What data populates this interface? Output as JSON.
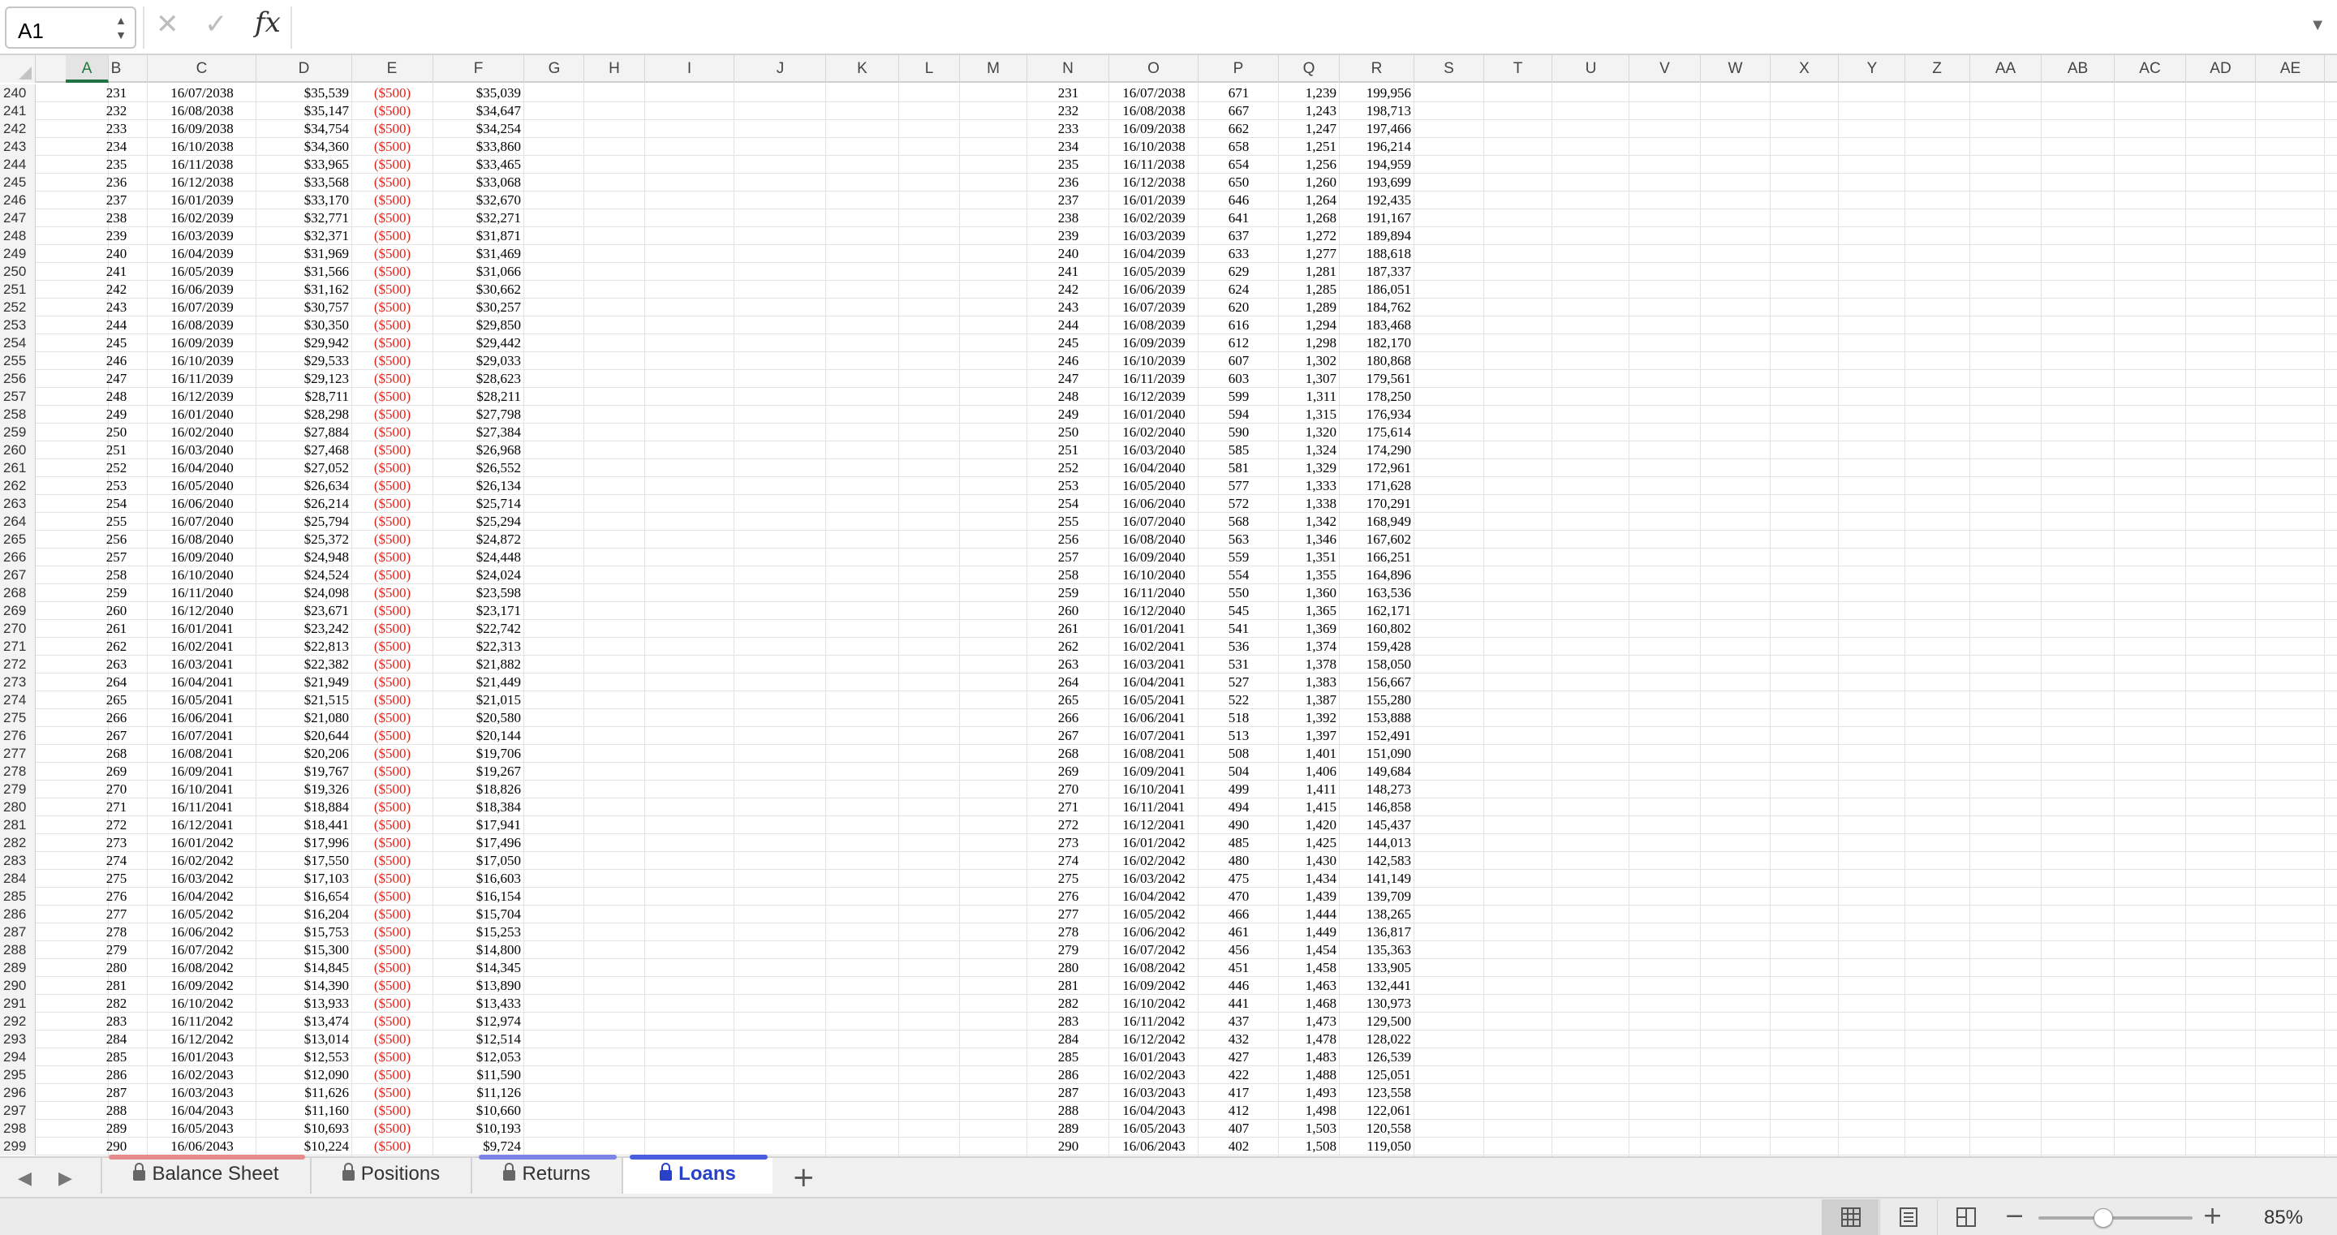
{
  "formula_bar": {
    "name_box": "A1",
    "formula": "",
    "cancel_glyph": "✕",
    "enter_glyph": "✓",
    "fx_label": "fx"
  },
  "columns": [
    "A",
    "B",
    "C",
    "D",
    "E",
    "F",
    "G",
    "H",
    "I",
    "J",
    "K",
    "L",
    "M",
    "N",
    "O",
    "P",
    "Q",
    "R",
    "S",
    "T",
    "U",
    "V",
    "W",
    "X",
    "Y",
    "Z",
    "AA",
    "AB",
    "AC",
    "AD",
    "AE"
  ],
  "active_column": "A",
  "rows": [
    {
      "r": "240",
      "b": "231",
      "c": "16/07/2038",
      "d": "$35,539",
      "e": "($500)",
      "f": "$35,039",
      "n": "231",
      "o": "16/07/2038",
      "p": "671",
      "q": "1,239",
      "rr": "199,956"
    },
    {
      "r": "241",
      "b": "232",
      "c": "16/08/2038",
      "d": "$35,147",
      "e": "($500)",
      "f": "$34,647",
      "n": "232",
      "o": "16/08/2038",
      "p": "667",
      "q": "1,243",
      "rr": "198,713"
    },
    {
      "r": "242",
      "b": "233",
      "c": "16/09/2038",
      "d": "$34,754",
      "e": "($500)",
      "f": "$34,254",
      "n": "233",
      "o": "16/09/2038",
      "p": "662",
      "q": "1,247",
      "rr": "197,466"
    },
    {
      "r": "243",
      "b": "234",
      "c": "16/10/2038",
      "d": "$34,360",
      "e": "($500)",
      "f": "$33,860",
      "n": "234",
      "o": "16/10/2038",
      "p": "658",
      "q": "1,251",
      "rr": "196,214"
    },
    {
      "r": "244",
      "b": "235",
      "c": "16/11/2038",
      "d": "$33,965",
      "e": "($500)",
      "f": "$33,465",
      "n": "235",
      "o": "16/11/2038",
      "p": "654",
      "q": "1,256",
      "rr": "194,959"
    },
    {
      "r": "245",
      "b": "236",
      "c": "16/12/2038",
      "d": "$33,568",
      "e": "($500)",
      "f": "$33,068",
      "n": "236",
      "o": "16/12/2038",
      "p": "650",
      "q": "1,260",
      "rr": "193,699"
    },
    {
      "r": "246",
      "b": "237",
      "c": "16/01/2039",
      "d": "$33,170",
      "e": "($500)",
      "f": "$32,670",
      "n": "237",
      "o": "16/01/2039",
      "p": "646",
      "q": "1,264",
      "rr": "192,435"
    },
    {
      "r": "247",
      "b": "238",
      "c": "16/02/2039",
      "d": "$32,771",
      "e": "($500)",
      "f": "$32,271",
      "n": "238",
      "o": "16/02/2039",
      "p": "641",
      "q": "1,268",
      "rr": "191,167"
    },
    {
      "r": "248",
      "b": "239",
      "c": "16/03/2039",
      "d": "$32,371",
      "e": "($500)",
      "f": "$31,871",
      "n": "239",
      "o": "16/03/2039",
      "p": "637",
      "q": "1,272",
      "rr": "189,894"
    },
    {
      "r": "249",
      "b": "240",
      "c": "16/04/2039",
      "d": "$31,969",
      "e": "($500)",
      "f": "$31,469",
      "n": "240",
      "o": "16/04/2039",
      "p": "633",
      "q": "1,277",
      "rr": "188,618"
    },
    {
      "r": "250",
      "b": "241",
      "c": "16/05/2039",
      "d": "$31,566",
      "e": "($500)",
      "f": "$31,066",
      "n": "241",
      "o": "16/05/2039",
      "p": "629",
      "q": "1,281",
      "rr": "187,337"
    },
    {
      "r": "251",
      "b": "242",
      "c": "16/06/2039",
      "d": "$31,162",
      "e": "($500)",
      "f": "$30,662",
      "n": "242",
      "o": "16/06/2039",
      "p": "624",
      "q": "1,285",
      "rr": "186,051"
    },
    {
      "r": "252",
      "b": "243",
      "c": "16/07/2039",
      "d": "$30,757",
      "e": "($500)",
      "f": "$30,257",
      "n": "243",
      "o": "16/07/2039",
      "p": "620",
      "q": "1,289",
      "rr": "184,762"
    },
    {
      "r": "253",
      "b": "244",
      "c": "16/08/2039",
      "d": "$30,350",
      "e": "($500)",
      "f": "$29,850",
      "n": "244",
      "o": "16/08/2039",
      "p": "616",
      "q": "1,294",
      "rr": "183,468"
    },
    {
      "r": "254",
      "b": "245",
      "c": "16/09/2039",
      "d": "$29,942",
      "e": "($500)",
      "f": "$29,442",
      "n": "245",
      "o": "16/09/2039",
      "p": "612",
      "q": "1,298",
      "rr": "182,170"
    },
    {
      "r": "255",
      "b": "246",
      "c": "16/10/2039",
      "d": "$29,533",
      "e": "($500)",
      "f": "$29,033",
      "n": "246",
      "o": "16/10/2039",
      "p": "607",
      "q": "1,302",
      "rr": "180,868"
    },
    {
      "r": "256",
      "b": "247",
      "c": "16/11/2039",
      "d": "$29,123",
      "e": "($500)",
      "f": "$28,623",
      "n": "247",
      "o": "16/11/2039",
      "p": "603",
      "q": "1,307",
      "rr": "179,561"
    },
    {
      "r": "257",
      "b": "248",
      "c": "16/12/2039",
      "d": "$28,711",
      "e": "($500)",
      "f": "$28,211",
      "n": "248",
      "o": "16/12/2039",
      "p": "599",
      "q": "1,311",
      "rr": "178,250"
    },
    {
      "r": "258",
      "b": "249",
      "c": "16/01/2040",
      "d": "$28,298",
      "e": "($500)",
      "f": "$27,798",
      "n": "249",
      "o": "16/01/2040",
      "p": "594",
      "q": "1,315",
      "rr": "176,934"
    },
    {
      "r": "259",
      "b": "250",
      "c": "16/02/2040",
      "d": "$27,884",
      "e": "($500)",
      "f": "$27,384",
      "n": "250",
      "o": "16/02/2040",
      "p": "590",
      "q": "1,320",
      "rr": "175,614"
    },
    {
      "r": "260",
      "b": "251",
      "c": "16/03/2040",
      "d": "$27,468",
      "e": "($500)",
      "f": "$26,968",
      "n": "251",
      "o": "16/03/2040",
      "p": "585",
      "q": "1,324",
      "rr": "174,290"
    },
    {
      "r": "261",
      "b": "252",
      "c": "16/04/2040",
      "d": "$27,052",
      "e": "($500)",
      "f": "$26,552",
      "n": "252",
      "o": "16/04/2040",
      "p": "581",
      "q": "1,329",
      "rr": "172,961"
    },
    {
      "r": "262",
      "b": "253",
      "c": "16/05/2040",
      "d": "$26,634",
      "e": "($500)",
      "f": "$26,134",
      "n": "253",
      "o": "16/05/2040",
      "p": "577",
      "q": "1,333",
      "rr": "171,628"
    },
    {
      "r": "263",
      "b": "254",
      "c": "16/06/2040",
      "d": "$26,214",
      "e": "($500)",
      "f": "$25,714",
      "n": "254",
      "o": "16/06/2040",
      "p": "572",
      "q": "1,338",
      "rr": "170,291"
    },
    {
      "r": "264",
      "b": "255",
      "c": "16/07/2040",
      "d": "$25,794",
      "e": "($500)",
      "f": "$25,294",
      "n": "255",
      "o": "16/07/2040",
      "p": "568",
      "q": "1,342",
      "rr": "168,949"
    },
    {
      "r": "265",
      "b": "256",
      "c": "16/08/2040",
      "d": "$25,372",
      "e": "($500)",
      "f": "$24,872",
      "n": "256",
      "o": "16/08/2040",
      "p": "563",
      "q": "1,346",
      "rr": "167,602"
    },
    {
      "r": "266",
      "b": "257",
      "c": "16/09/2040",
      "d": "$24,948",
      "e": "($500)",
      "f": "$24,448",
      "n": "257",
      "o": "16/09/2040",
      "p": "559",
      "q": "1,351",
      "rr": "166,251"
    },
    {
      "r": "267",
      "b": "258",
      "c": "16/10/2040",
      "d": "$24,524",
      "e": "($500)",
      "f": "$24,024",
      "n": "258",
      "o": "16/10/2040",
      "p": "554",
      "q": "1,355",
      "rr": "164,896"
    },
    {
      "r": "268",
      "b": "259",
      "c": "16/11/2040",
      "d": "$24,098",
      "e": "($500)",
      "f": "$23,598",
      "n": "259",
      "o": "16/11/2040",
      "p": "550",
      "q": "1,360",
      "rr": "163,536"
    },
    {
      "r": "269",
      "b": "260",
      "c": "16/12/2040",
      "d": "$23,671",
      "e": "($500)",
      "f": "$23,171",
      "n": "260",
      "o": "16/12/2040",
      "p": "545",
      "q": "1,365",
      "rr": "162,171"
    },
    {
      "r": "270",
      "b": "261",
      "c": "16/01/2041",
      "d": "$23,242",
      "e": "($500)",
      "f": "$22,742",
      "n": "261",
      "o": "16/01/2041",
      "p": "541",
      "q": "1,369",
      "rr": "160,802"
    },
    {
      "r": "271",
      "b": "262",
      "c": "16/02/2041",
      "d": "$22,813",
      "e": "($500)",
      "f": "$22,313",
      "n": "262",
      "o": "16/02/2041",
      "p": "536",
      "q": "1,374",
      "rr": "159,428"
    },
    {
      "r": "272",
      "b": "263",
      "c": "16/03/2041",
      "d": "$22,382",
      "e": "($500)",
      "f": "$21,882",
      "n": "263",
      "o": "16/03/2041",
      "p": "531",
      "q": "1,378",
      "rr": "158,050"
    },
    {
      "r": "273",
      "b": "264",
      "c": "16/04/2041",
      "d": "$21,949",
      "e": "($500)",
      "f": "$21,449",
      "n": "264",
      "o": "16/04/2041",
      "p": "527",
      "q": "1,383",
      "rr": "156,667"
    },
    {
      "r": "274",
      "b": "265",
      "c": "16/05/2041",
      "d": "$21,515",
      "e": "($500)",
      "f": "$21,015",
      "n": "265",
      "o": "16/05/2041",
      "p": "522",
      "q": "1,387",
      "rr": "155,280"
    },
    {
      "r": "275",
      "b": "266",
      "c": "16/06/2041",
      "d": "$21,080",
      "e": "($500)",
      "f": "$20,580",
      "n": "266",
      "o": "16/06/2041",
      "p": "518",
      "q": "1,392",
      "rr": "153,888"
    },
    {
      "r": "276",
      "b": "267",
      "c": "16/07/2041",
      "d": "$20,644",
      "e": "($500)",
      "f": "$20,144",
      "n": "267",
      "o": "16/07/2041",
      "p": "513",
      "q": "1,397",
      "rr": "152,491"
    },
    {
      "r": "277",
      "b": "268",
      "c": "16/08/2041",
      "d": "$20,206",
      "e": "($500)",
      "f": "$19,706",
      "n": "268",
      "o": "16/08/2041",
      "p": "508",
      "q": "1,401",
      "rr": "151,090"
    },
    {
      "r": "278",
      "b": "269",
      "c": "16/09/2041",
      "d": "$19,767",
      "e": "($500)",
      "f": "$19,267",
      "n": "269",
      "o": "16/09/2041",
      "p": "504",
      "q": "1,406",
      "rr": "149,684"
    },
    {
      "r": "279",
      "b": "270",
      "c": "16/10/2041",
      "d": "$19,326",
      "e": "($500)",
      "f": "$18,826",
      "n": "270",
      "o": "16/10/2041",
      "p": "499",
      "q": "1,411",
      "rr": "148,273"
    },
    {
      "r": "280",
      "b": "271",
      "c": "16/11/2041",
      "d": "$18,884",
      "e": "($500)",
      "f": "$18,384",
      "n": "271",
      "o": "16/11/2041",
      "p": "494",
      "q": "1,415",
      "rr": "146,858"
    },
    {
      "r": "281",
      "b": "272",
      "c": "16/12/2041",
      "d": "$18,441",
      "e": "($500)",
      "f": "$17,941",
      "n": "272",
      "o": "16/12/2041",
      "p": "490",
      "q": "1,420",
      "rr": "145,437"
    },
    {
      "r": "282",
      "b": "273",
      "c": "16/01/2042",
      "d": "$17,996",
      "e": "($500)",
      "f": "$17,496",
      "n": "273",
      "o": "16/01/2042",
      "p": "485",
      "q": "1,425",
      "rr": "144,013"
    },
    {
      "r": "283",
      "b": "274",
      "c": "16/02/2042",
      "d": "$17,550",
      "e": "($500)",
      "f": "$17,050",
      "n": "274",
      "o": "16/02/2042",
      "p": "480",
      "q": "1,430",
      "rr": "142,583"
    },
    {
      "r": "284",
      "b": "275",
      "c": "16/03/2042",
      "d": "$17,103",
      "e": "($500)",
      "f": "$16,603",
      "n": "275",
      "o": "16/03/2042",
      "p": "475",
      "q": "1,434",
      "rr": "141,149"
    },
    {
      "r": "285",
      "b": "276",
      "c": "16/04/2042",
      "d": "$16,654",
      "e": "($500)",
      "f": "$16,154",
      "n": "276",
      "o": "16/04/2042",
      "p": "470",
      "q": "1,439",
      "rr": "139,709"
    },
    {
      "r": "286",
      "b": "277",
      "c": "16/05/2042",
      "d": "$16,204",
      "e": "($500)",
      "f": "$15,704",
      "n": "277",
      "o": "16/05/2042",
      "p": "466",
      "q": "1,444",
      "rr": "138,265"
    },
    {
      "r": "287",
      "b": "278",
      "c": "16/06/2042",
      "d": "$15,753",
      "e": "($500)",
      "f": "$15,253",
      "n": "278",
      "o": "16/06/2042",
      "p": "461",
      "q": "1,449",
      "rr": "136,817"
    },
    {
      "r": "288",
      "b": "279",
      "c": "16/07/2042",
      "d": "$15,300",
      "e": "($500)",
      "f": "$14,800",
      "n": "279",
      "o": "16/07/2042",
      "p": "456",
      "q": "1,454",
      "rr": "135,363"
    },
    {
      "r": "289",
      "b": "280",
      "c": "16/08/2042",
      "d": "$14,845",
      "e": "($500)",
      "f": "$14,345",
      "n": "280",
      "o": "16/08/2042",
      "p": "451",
      "q": "1,458",
      "rr": "133,905"
    },
    {
      "r": "290",
      "b": "281",
      "c": "16/09/2042",
      "d": "$14,390",
      "e": "($500)",
      "f": "$13,890",
      "n": "281",
      "o": "16/09/2042",
      "p": "446",
      "q": "1,463",
      "rr": "132,441"
    },
    {
      "r": "291",
      "b": "282",
      "c": "16/10/2042",
      "d": "$13,933",
      "e": "($500)",
      "f": "$13,433",
      "n": "282",
      "o": "16/10/2042",
      "p": "441",
      "q": "1,468",
      "rr": "130,973"
    },
    {
      "r": "292",
      "b": "283",
      "c": "16/11/2042",
      "d": "$13,474",
      "e": "($500)",
      "f": "$12,974",
      "n": "283",
      "o": "16/11/2042",
      "p": "437",
      "q": "1,473",
      "rr": "129,500"
    },
    {
      "r": "293",
      "b": "284",
      "c": "16/12/2042",
      "d": "$13,014",
      "e": "($500)",
      "f": "$12,514",
      "n": "284",
      "o": "16/12/2042",
      "p": "432",
      "q": "1,478",
      "rr": "128,022"
    },
    {
      "r": "294",
      "b": "285",
      "c": "16/01/2043",
      "d": "$12,553",
      "e": "($500)",
      "f": "$12,053",
      "n": "285",
      "o": "16/01/2043",
      "p": "427",
      "q": "1,483",
      "rr": "126,539"
    },
    {
      "r": "295",
      "b": "286",
      "c": "16/02/2043",
      "d": "$12,090",
      "e": "($500)",
      "f": "$11,590",
      "n": "286",
      "o": "16/02/2043",
      "p": "422",
      "q": "1,488",
      "rr": "125,051"
    },
    {
      "r": "296",
      "b": "287",
      "c": "16/03/2043",
      "d": "$11,626",
      "e": "($500)",
      "f": "$11,126",
      "n": "287",
      "o": "16/03/2043",
      "p": "417",
      "q": "1,493",
      "rr": "123,558"
    },
    {
      "r": "297",
      "b": "288",
      "c": "16/04/2043",
      "d": "$11,160",
      "e": "($500)",
      "f": "$10,660",
      "n": "288",
      "o": "16/04/2043",
      "p": "412",
      "q": "1,498",
      "rr": "122,061"
    },
    {
      "r": "298",
      "b": "289",
      "c": "16/05/2043",
      "d": "$10,693",
      "e": "($500)",
      "f": "$10,193",
      "n": "289",
      "o": "16/05/2043",
      "p": "407",
      "q": "1,503",
      "rr": "120,558"
    },
    {
      "r": "299",
      "b": "290",
      "c": "16/06/2043",
      "d": "$10,224",
      "e": "($500)",
      "f": "$9,724",
      "n": "290",
      "o": "16/06/2043",
      "p": "402",
      "q": "1,508",
      "rr": "119,050"
    }
  ],
  "tabs": [
    {
      "label": "Balance Sheet",
      "locked": true,
      "active": false,
      "strip_color": "#e58b8b"
    },
    {
      "label": "Positions",
      "locked": true,
      "active": false,
      "strip_color": ""
    },
    {
      "label": "Returns",
      "locked": true,
      "active": false,
      "strip_color": "#7a85e6"
    },
    {
      "label": "Loans",
      "locked": true,
      "active": true,
      "strip_color": "#4a5fe0"
    }
  ],
  "add_sheet_glyph": "+",
  "status_bar": {
    "zoom_level": "85%",
    "zoom_fraction": 0.42,
    "active_view": "normal"
  },
  "colors": {
    "negative": "#e0241b",
    "active_tab_text": "#2742c7",
    "active_column_accent": "#217346"
  }
}
